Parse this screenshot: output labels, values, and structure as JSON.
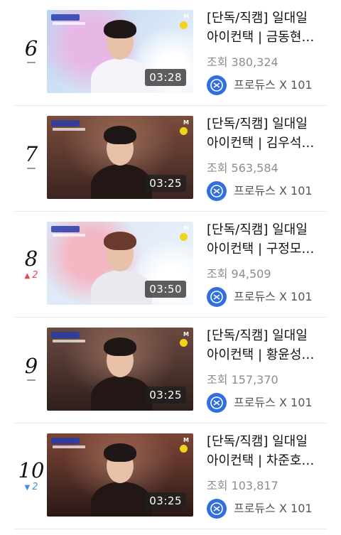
{
  "items": [
    {
      "rank": "6",
      "rank_change": "",
      "rank_change_dir": "",
      "duration": "03:28",
      "title_line1": "[단독/직캠] 일대일",
      "title_line2": "아이컨택 | 금동현…",
      "views": "조회 380,324",
      "channel": "프로듀스 X 101",
      "thumb_bg": "#b9d4f0",
      "thumb_accent": "#e7b8e6",
      "mnet_label": "M"
    },
    {
      "rank": "7",
      "rank_change": "",
      "rank_change_dir": "",
      "duration": "03:25",
      "title_line1": "[단독/직캠] 일대일",
      "title_line2": "아이컨택 | 김우석…",
      "views": "조회 563,584",
      "channel": "프로듀스 X 101",
      "thumb_bg": "#7a4c3c",
      "thumb_accent": "#3b2420",
      "mnet_label": "M"
    },
    {
      "rank": "8",
      "rank_change": "2",
      "rank_change_dir": "up",
      "duration": "03:50",
      "title_line1": "[단독/직캠] 일대일",
      "title_line2": "아이컨택 | 구정모…",
      "views": "조회 94,509",
      "channel": "프로듀스 X 101",
      "thumb_bg": "#d7e4f6",
      "thumb_accent": "#f3b8c4",
      "mnet_label": "M"
    },
    {
      "rank": "9",
      "rank_change": "",
      "rank_change_dir": "",
      "duration": "03:25",
      "title_line1": "[단독/직캠] 일대일",
      "title_line2": "아이컨택 | 황윤성…",
      "views": "조회 157,370",
      "channel": "프로듀스 X 101",
      "thumb_bg": "#6b4a40",
      "thumb_accent": "#2e1e1c",
      "mnet_label": "M"
    },
    {
      "rank": "10",
      "rank_change": "2",
      "rank_change_dir": "down",
      "duration": "03:25",
      "title_line1": "[단독/직캠] 일대일",
      "title_line2": "아이컨택 | 차준호…",
      "views": "조회 103,817",
      "channel": "프로듀스 X 101",
      "thumb_bg": "#7d4536",
      "thumb_accent": "#2a1816",
      "mnet_label": "M"
    }
  ],
  "icons": {
    "rank_up": "triangle-up-icon",
    "rank_down": "triangle-down-icon",
    "channel_avatar": "produce-x-101-logo-icon"
  },
  "colors": {
    "rank_up": "#e8434a",
    "rank_down": "#3d8fe0",
    "channel_avatar": "#2f6fe2"
  }
}
